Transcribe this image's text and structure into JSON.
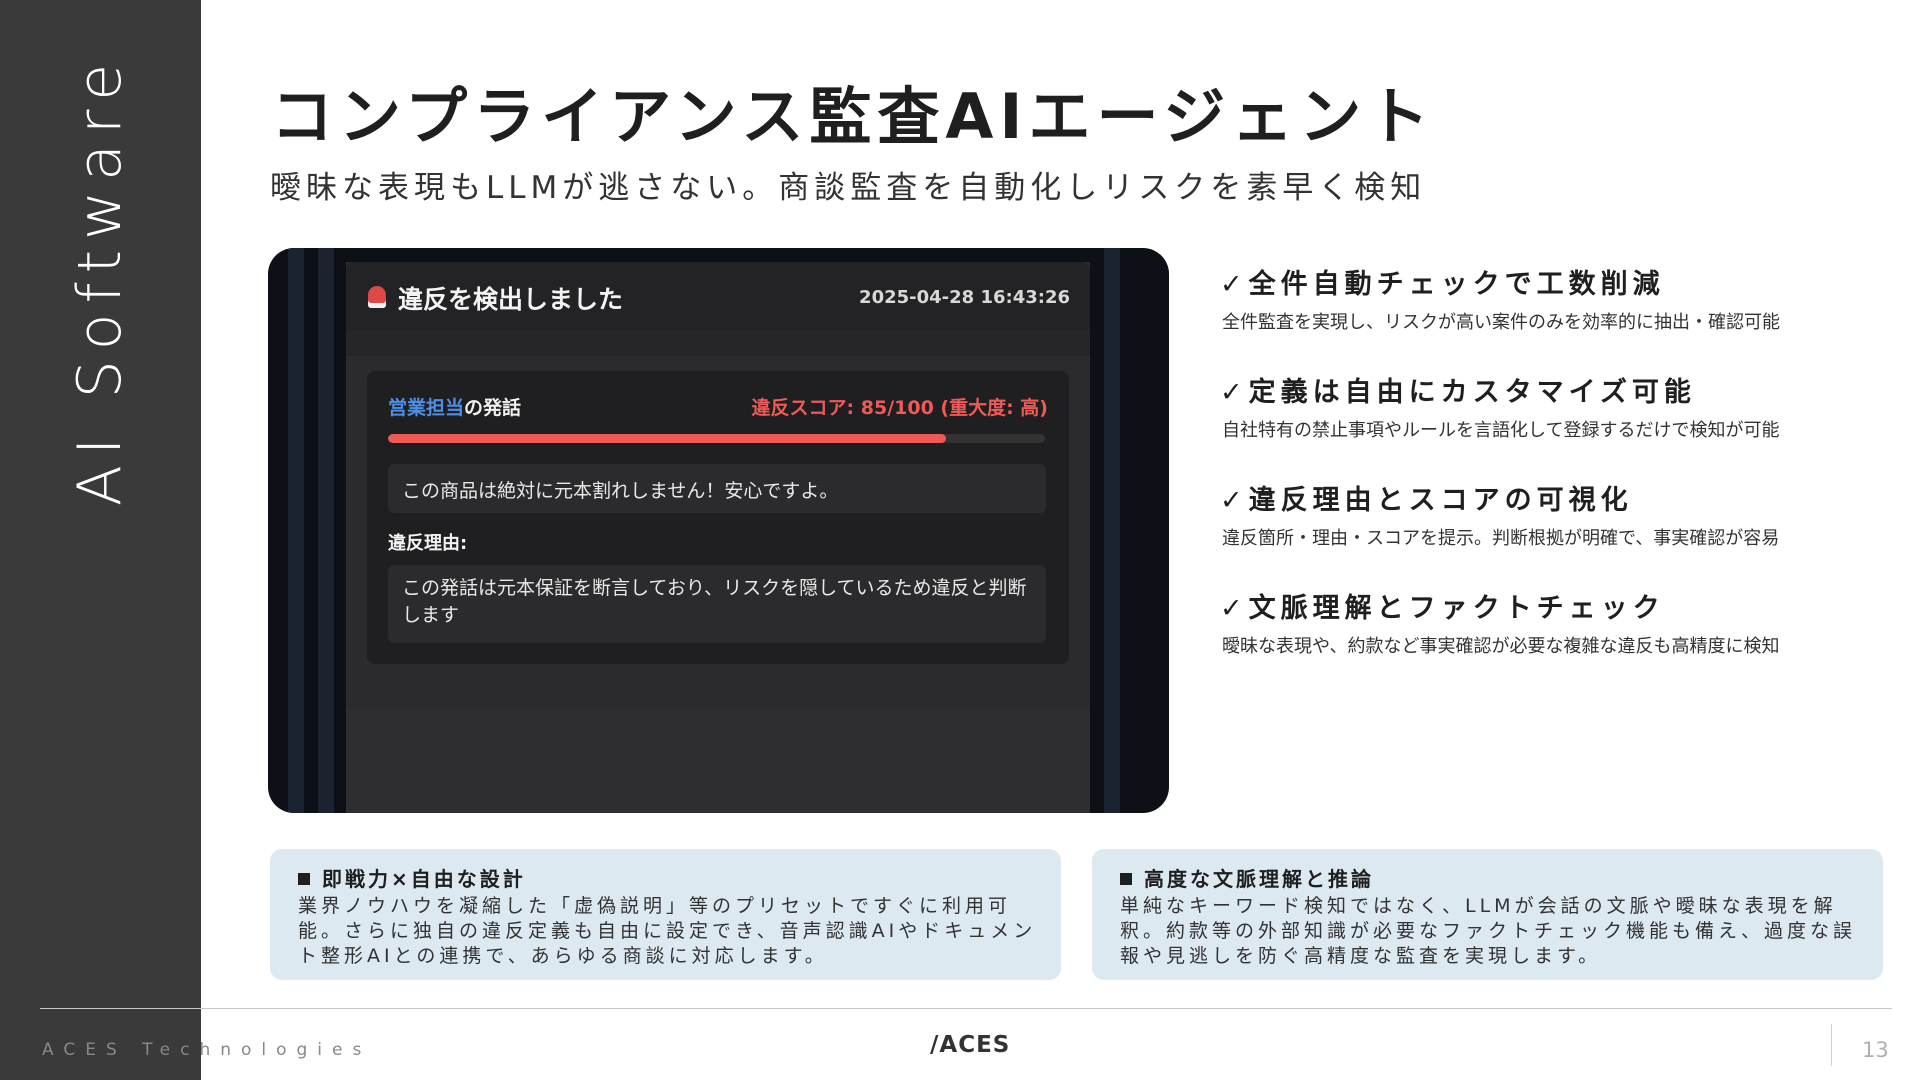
{
  "sidebar": {
    "label": "AI Software"
  },
  "header": {
    "title": "コンプライアンス監査AIエージェント",
    "subtitle": "曖昧な表現もLLMが逃さない。商談監査を自動化しリスクを素早く検知"
  },
  "mockup": {
    "alert_title": "違反を検出しました",
    "timestamp": "2025-04-28 16:43:26",
    "speaker_role": "営業担当",
    "speaker_suffix": "の発話",
    "score_text": "違反スコア: 85/100 (重大度: 高)",
    "score_value": 85,
    "score_max": 100,
    "quote": "この商品は絶対に元本割れしません！安心ですよ。",
    "reason_label": "違反理由:",
    "reason": "この発話は元本保証を断言しており、リスクを隠しているため違反と判断します",
    "colors": {
      "accent_red": "#ef5a57",
      "accent_blue": "#4e8fe6"
    }
  },
  "features": [
    {
      "title": "全件自動チェックで工数削減",
      "desc": "全件監査を実現し、リスクが高い案件のみを効率的に抽出・確認可能"
    },
    {
      "title": "定義は自由にカスタマイズ可能",
      "desc": "自社特有の禁止事項やルールを言語化して登録するだけで検知が可能"
    },
    {
      "title": "違反理由とスコアの可視化",
      "desc": "違反箇所・理由・スコアを提示。判断根拠が明確で、事実確認が容易"
    },
    {
      "title": "文脈理解とファクトチェック",
      "desc": "曖昧な表現や、約款など事実確認が必要な複雑な違反も高精度に検知"
    }
  ],
  "check_glyph": "✓",
  "boxes": [
    {
      "title": "即戦力×自由な設計",
      "text": "業界ノウハウを凝縮した「虚偽説明」等のプリセットですぐに利用可能。さらに独自の違反定義も自由に設定でき、音声認識AIやドキュメント整形AIとの連携で、あらゆる商談に対応します。"
    },
    {
      "title": "高度な文脈理解と推論",
      "text": "単純なキーワード検知ではなく、LLMが会話の文脈や曖昧な表現を解釈。約款等の外部知識が必要なファクトチェック機能も備え、過度な誤報や見逃しを防ぐ高精度な監査を実現します。"
    }
  ],
  "footer": {
    "company": "ACES Technologies",
    "logo": "/ACES",
    "page": "13"
  }
}
